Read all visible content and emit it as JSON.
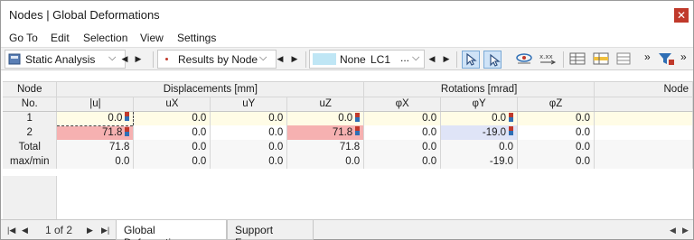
{
  "window": {
    "title": "Nodes | Global Deformations",
    "close_glyph": "✕"
  },
  "menu": [
    "Go To",
    "Edit",
    "Selection",
    "View",
    "Settings"
  ],
  "toolbar": {
    "analysis_combo": "Static Analysis",
    "results_combo": "Results by Node",
    "lc_none": "None",
    "lc_name": "LC1",
    "lc_more": "...",
    "overflow": "»",
    "nav_prev": "◀",
    "nav_next": "▶"
  },
  "grid": {
    "header_node": [
      "Node",
      "No."
    ],
    "group_displacements": "Displacements [mm]",
    "group_rotations": "Rotations [mrad]",
    "group_node": "Node",
    "columns": [
      "|u|",
      "uX",
      "uY",
      "uZ",
      "φX",
      "φY",
      "φZ"
    ],
    "rows": [
      {
        "label": "1",
        "values": [
          "0.0",
          "0.0",
          "0.0",
          "0.0",
          "0.0",
          "0.0",
          "0.0"
        ]
      },
      {
        "label": "2",
        "values": [
          "71.8",
          "0.0",
          "0.0",
          "71.8",
          "0.0",
          "-19.0",
          "0.0"
        ]
      },
      {
        "label": "Total",
        "values": [
          "71.8",
          "0.0",
          "0.0",
          "71.8",
          "0.0",
          "0.0",
          "0.0"
        ]
      },
      {
        "label": "max/min",
        "values": [
          "0.0",
          "0.0",
          "0.0",
          "0.0",
          "0.0",
          "-19.0",
          "0.0"
        ]
      }
    ]
  },
  "pager": {
    "text": "1 of 2",
    "first": "|◀",
    "prev": "◀",
    "next": "▶",
    "last": "▶|"
  },
  "tabs": [
    {
      "label": "Global Deformations",
      "active": true
    },
    {
      "label": "Support Forces",
      "active": false
    }
  ],
  "colors": {
    "highlight_red": "#f6b1b1",
    "highlight_blue": "#dfe4f7",
    "selection_row": "#fffce6",
    "accent_blue": "#2f6fb5"
  }
}
